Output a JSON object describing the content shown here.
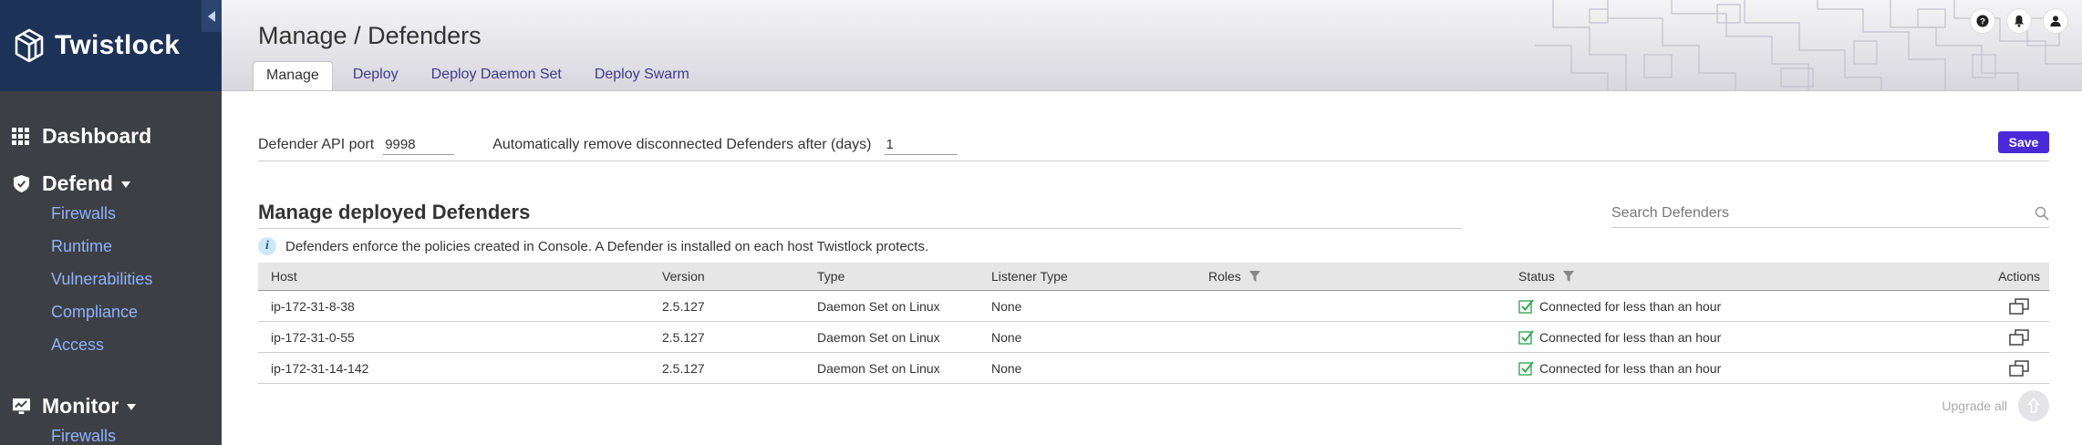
{
  "brand": {
    "name": "Twistlock"
  },
  "sidebar": {
    "items": [
      {
        "label": "Dashboard",
        "icon": "grid-icon"
      },
      {
        "label": "Defend",
        "icon": "shield-icon",
        "children": [
          "Firewalls",
          "Runtime",
          "Vulnerabilities",
          "Compliance",
          "Access"
        ]
      },
      {
        "label": "Monitor",
        "icon": "monitor-icon",
        "children": [
          "Firewalls"
        ]
      }
    ]
  },
  "header": {
    "title": "Manage / Defenders",
    "tabs": [
      "Manage",
      "Deploy",
      "Deploy Daemon Set",
      "Deploy Swarm"
    ],
    "active_tab": "Manage"
  },
  "settings": {
    "api_port_label": "Defender API port",
    "api_port_value": "9998",
    "auto_remove_label": "Automatically remove disconnected Defenders after (days)",
    "auto_remove_value": "1",
    "save_label": "Save"
  },
  "section": {
    "title": "Manage deployed Defenders",
    "search_placeholder": "Search Defenders",
    "info_text": "Defenders enforce the policies created in Console. A Defender is installed on each host Twistlock protects."
  },
  "table": {
    "columns": [
      "Host",
      "Version",
      "Type",
      "Listener Type",
      "Roles",
      "Status",
      "Actions"
    ],
    "rows": [
      {
        "host": "ip-172-31-8-38",
        "version": "2.5.127",
        "type": "Daemon Set on Linux",
        "listener": "None",
        "roles": "",
        "status": "Connected for less than an hour"
      },
      {
        "host": "ip-172-31-0-55",
        "version": "2.5.127",
        "type": "Daemon Set on Linux",
        "listener": "None",
        "roles": "",
        "status": "Connected for less than an hour"
      },
      {
        "host": "ip-172-31-14-142",
        "version": "2.5.127",
        "type": "Daemon Set on Linux",
        "listener": "None",
        "roles": "",
        "status": "Connected for less than an hour"
      }
    ]
  },
  "footer": {
    "upgrade_label": "Upgrade all"
  },
  "colors": {
    "sidebar_bg": "#3c3f43",
    "brand_bg": "#1d3257",
    "accent": "#4a2ad8",
    "link": "#8fb3ff",
    "success": "#3aa655"
  }
}
